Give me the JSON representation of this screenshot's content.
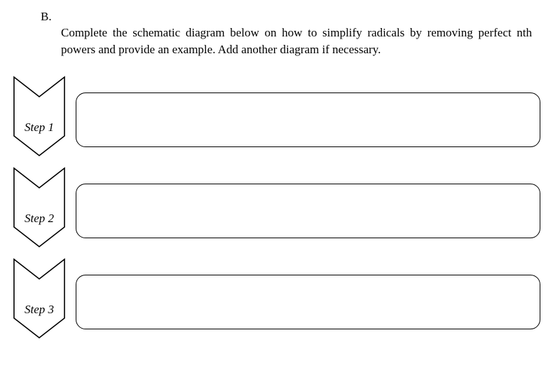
{
  "instruction": {
    "prefix": "B.",
    "text": "Complete the schematic diagram below on how to simplify radicals by removing perfect nth powers and provide an example. Add another diagram if necessary."
  },
  "steps": [
    {
      "label": "Step 1",
      "content": ""
    },
    {
      "label": "Step 2",
      "content": ""
    },
    {
      "label": "Step 3",
      "content": ""
    }
  ]
}
